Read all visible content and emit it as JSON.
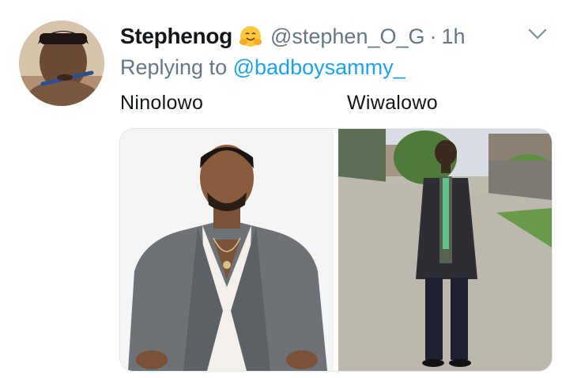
{
  "tweet": {
    "display_name": "Stephenog",
    "handle": "@stephen_O_G",
    "separator": "·",
    "time": "1h",
    "reply_prefix": "Replying to",
    "reply_to_user": "@badboysammy_",
    "caption_left": "Ninolowo",
    "caption_right": "Wiwalowo"
  },
  "icons": {
    "name_emoji": "hugging-face-emoji",
    "menu": "chevron-down-icon"
  },
  "colors": {
    "text_primary": "#14171a",
    "text_secondary": "#657786",
    "link": "#1da1f2",
    "border": "#e1e8ed"
  }
}
